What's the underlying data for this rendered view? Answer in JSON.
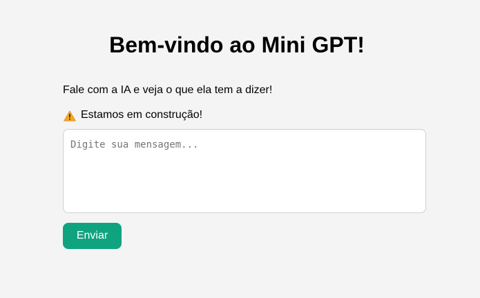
{
  "header": {
    "title": "Bem-vindo ao Mini GPT!"
  },
  "main": {
    "subtitle": "Fale com a IA e veja o que ela tem a dizer!",
    "notice": {
      "icon": "warning-icon",
      "text": "Estamos em construção!"
    },
    "message_input": {
      "value": "",
      "placeholder": "Digite sua mensagem..."
    },
    "send_button": {
      "label": "Enviar"
    }
  },
  "colors": {
    "background": "#f4f4f4",
    "accent": "#10a37f",
    "warning": "#f5a623"
  }
}
